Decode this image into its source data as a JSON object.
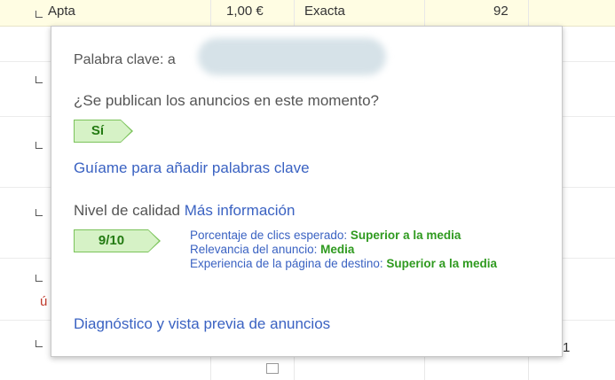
{
  "background_table": {
    "first_row": {
      "col1": "Apta",
      "col2": "1,00 €",
      "col3": "Exacta",
      "col4": "92"
    },
    "edge_glyph": "ú",
    "right_edge_char": "1"
  },
  "popup": {
    "keyword_label": "Palabra clave:",
    "keyword_visible_prefix": "a",
    "question": "¿Se publican los anuncios en este momento?",
    "status_tag": "Sí",
    "guide_link": "Guíame para añadir palabras clave",
    "quality_label": "Nivel de calidad",
    "more_info_link": "Más información",
    "score_tag": "9/10",
    "metrics": [
      {
        "label": "Porcentaje de clics esperado:",
        "value": "Superior a la media"
      },
      {
        "label": "Relevancia del anuncio:",
        "value": "Media"
      },
      {
        "label": "Experiencia de la página de destino:",
        "value": "Superior a la media"
      }
    ],
    "diagnostic_link": "Diagnóstico y vista previa de anuncios"
  },
  "colors": {
    "link": "#3a62c2",
    "tag_fill": "#d6f2c6",
    "tag_border": "#7bc35a",
    "tag_text": "#237a12",
    "metric_value": "#2f9a1f",
    "highlight_row": "#fffde3"
  },
  "icons": [
    "row-checkbox-icon",
    "status-arrow-tag",
    "score-arrow-tag"
  ]
}
